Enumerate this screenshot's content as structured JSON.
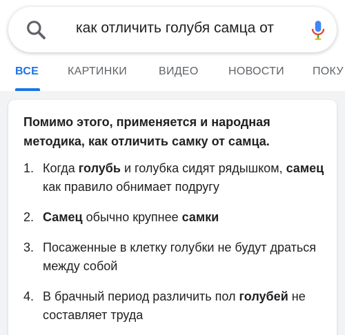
{
  "search": {
    "query": "как отличить голубя самца от"
  },
  "tabs": [
    {
      "label": "ВСЕ",
      "active": true
    },
    {
      "label": "КАРТИНКИ",
      "active": false
    },
    {
      "label": "ВИДЕО",
      "active": false
    },
    {
      "label": "НОВОСТИ",
      "active": false
    },
    {
      "label": "ПОКУ",
      "active": false
    }
  ],
  "snippet": {
    "heading": "Помимо этого, применяется и народная методика, как отличить самку от самца.",
    "items": [
      {
        "num": "1.",
        "parts": [
          {
            "text": "Когда ",
            "bold": false
          },
          {
            "text": "голубь",
            "bold": true
          },
          {
            "text": " и голубка сидят рядышком, ",
            "bold": false
          },
          {
            "text": "самец",
            "bold": true
          },
          {
            "text": " как правило обнимает подругу",
            "bold": false
          }
        ]
      },
      {
        "num": "2.",
        "parts": [
          {
            "text": "Самец",
            "bold": true
          },
          {
            "text": " обычно крупнее ",
            "bold": false
          },
          {
            "text": "самки",
            "bold": true
          }
        ]
      },
      {
        "num": "3.",
        "parts": [
          {
            "text": "Посаженные в клетку голубки не будут драться между собой",
            "bold": false
          }
        ]
      },
      {
        "num": "4.",
        "parts": [
          {
            "text": "В брачный период различить пол ",
            "bold": false
          },
          {
            "text": "голубей",
            "bold": true
          },
          {
            "text": " не составляет труда",
            "bold": false
          }
        ]
      }
    ]
  },
  "colors": {
    "accent": "#1a73e8",
    "text": "#202124",
    "muted": "#5f6368",
    "background": "#f1f3f4"
  },
  "icons": [
    "search-icon",
    "microphone-icon"
  ]
}
